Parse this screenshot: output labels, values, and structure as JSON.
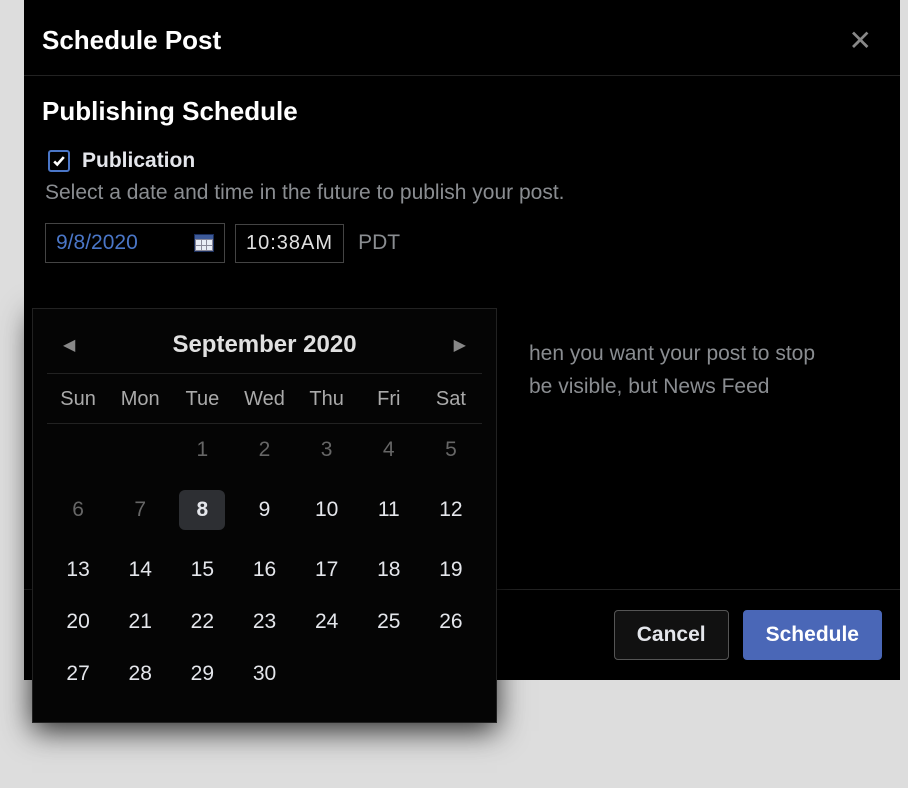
{
  "modal": {
    "title": "Schedule Post",
    "section_title": "Publishing Schedule",
    "publication_label": "Publication",
    "publication_checked": true,
    "help_text": "Select a date and time in the future to publish your post.",
    "date_value": "9/8/2020",
    "time_value": "10:38AM",
    "timezone": "PDT",
    "secondary_line1": "hen you want your post to stop",
    "secondary_line2": "be visible, but News Feed",
    "cancel_label": "Cancel",
    "schedule_label": "Schedule"
  },
  "calendar": {
    "month_year": "September 2020",
    "day_headers": [
      "Sun",
      "Mon",
      "Tue",
      "Wed",
      "Thu",
      "Fri",
      "Sat"
    ],
    "selected_day": 8,
    "weeks": [
      [
        {
          "n": null
        },
        {
          "n": null
        },
        {
          "n": 1,
          "disabled": true
        },
        {
          "n": 2,
          "disabled": true
        },
        {
          "n": 3,
          "disabled": true
        },
        {
          "n": 4,
          "disabled": true
        },
        {
          "n": 5,
          "disabled": true
        }
      ],
      [
        {
          "n": 6,
          "disabled": true
        },
        {
          "n": 7,
          "disabled": true
        },
        {
          "n": 8,
          "selected": true
        },
        {
          "n": 9
        },
        {
          "n": 10
        },
        {
          "n": 11
        },
        {
          "n": 12
        }
      ],
      [
        {
          "n": 13
        },
        {
          "n": 14
        },
        {
          "n": 15
        },
        {
          "n": 16
        },
        {
          "n": 17
        },
        {
          "n": 18
        },
        {
          "n": 19
        }
      ],
      [
        {
          "n": 20
        },
        {
          "n": 21
        },
        {
          "n": 22
        },
        {
          "n": 23
        },
        {
          "n": 24
        },
        {
          "n": 25
        },
        {
          "n": 26
        }
      ],
      [
        {
          "n": 27
        },
        {
          "n": 28
        },
        {
          "n": 29
        },
        {
          "n": 30
        },
        {
          "n": null
        },
        {
          "n": null
        },
        {
          "n": null
        }
      ]
    ]
  }
}
